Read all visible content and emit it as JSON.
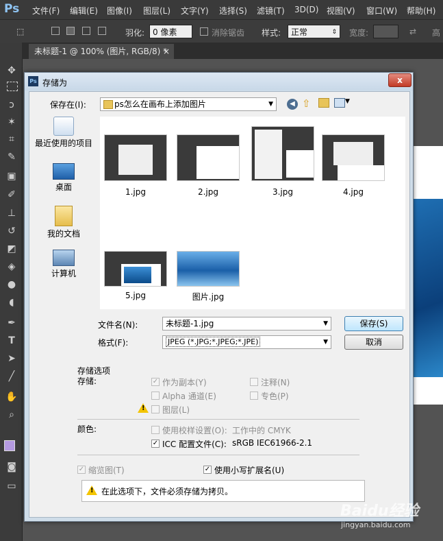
{
  "ps_logo": "Ps",
  "menu": [
    "文件(F)",
    "编辑(E)",
    "图像(I)",
    "图层(L)",
    "文字(Y)",
    "选择(S)",
    "滤镜(T)",
    "3D(D)",
    "视图(V)",
    "窗口(W)",
    "帮助(H)"
  ],
  "options_bar": {
    "feather_label": "羽化:",
    "feather_value": "0 像素",
    "antialias_label": "消除锯齿",
    "style_label": "样式:",
    "style_value": "正常",
    "width_label": "宽度:",
    "height_label": "高"
  },
  "document_tab": "未标题-1 @ 100% (图片, RGB/8) *",
  "document_tab_close": "×",
  "dialog": {
    "title": "存储为",
    "close": "x",
    "save_in_label": "保存在(I):",
    "save_in_value": "ps怎么在画布上添加图片",
    "places": [
      {
        "label": "最近使用的项目",
        "icon": "recent-items-icon"
      },
      {
        "label": "桌面",
        "icon": "desktop-icon"
      },
      {
        "label": "我的文档",
        "icon": "my-documents-icon"
      },
      {
        "label": "计算机",
        "icon": "computer-icon"
      }
    ],
    "files": [
      {
        "name": "1.jpg"
      },
      {
        "name": "2.jpg"
      },
      {
        "name": "3.jpg"
      },
      {
        "name": "4.jpg"
      },
      {
        "name": "5.jpg"
      },
      {
        "name": "图片.jpg"
      }
    ],
    "filename_label": "文件名(N):",
    "filename_value": "未标题-1.jpg",
    "format_label": "格式(F):",
    "format_value": "JPEG (*.JPG;*.JPEG;*.JPE)",
    "save_button": "保存(S)",
    "cancel_button": "取消",
    "options": {
      "group_title": "存储选项",
      "save_label": "存储:",
      "as_copy": "作为副本(Y)",
      "annotations": "注释(N)",
      "alpha": "Alpha 通道(E)",
      "spot": "专色(P)",
      "layers": "图层(L)",
      "color_label": "颜色:",
      "proof": "使用校样设置(O):",
      "proof_value": "工作中的 CMYK",
      "icc": "ICC 配置文件(C):",
      "icc_value": "sRGB IEC61966-2.1",
      "thumbnail": "缩览图(T)",
      "lowercase_ext": "使用小写扩展名(U)",
      "info_message": "在此选项下，文件必须存储为拷贝。"
    }
  },
  "watermark": "Baidu经验",
  "watermark_url": "jingyan.baidu.com"
}
